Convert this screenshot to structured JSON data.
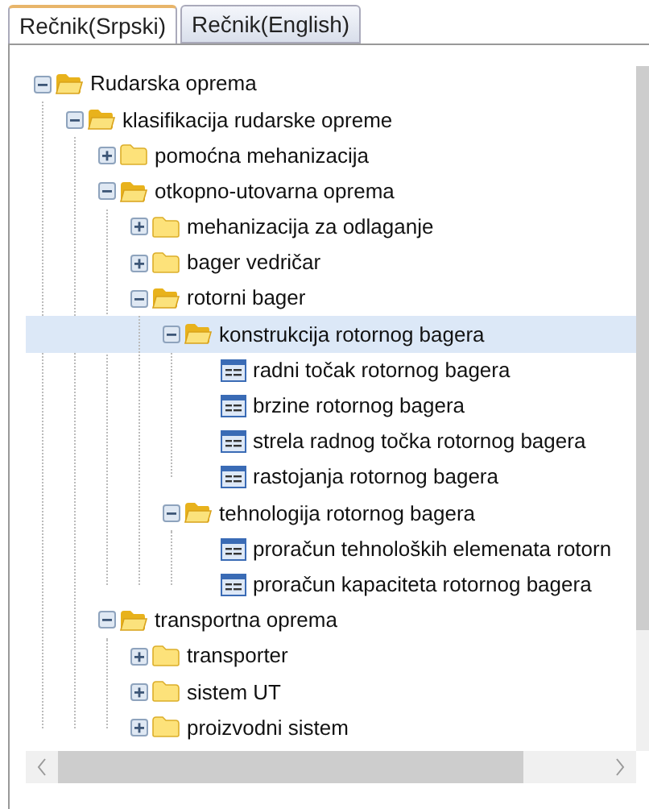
{
  "tabs": [
    {
      "label": "Rečnik(Srpski)",
      "selected": true
    },
    {
      "label": "Rečnik(English)",
      "selected": false
    }
  ],
  "tree": [
    {
      "label": "Rudarska oprema",
      "kind": "folder",
      "expanded": true,
      "selected": false,
      "children": [
        {
          "label": "klasifikacija rudarske opreme",
          "kind": "folder",
          "expanded": true,
          "selected": false,
          "children": [
            {
              "label": "pomoćna mehanizacija",
              "kind": "folder",
              "expanded": false,
              "selected": false
            },
            {
              "label": "otkopno-utovarna oprema",
              "kind": "folder",
              "expanded": true,
              "selected": false,
              "children": [
                {
                  "label": "mehanizacija za odlaganje",
                  "kind": "folder",
                  "expanded": false,
                  "selected": false
                },
                {
                  "label": "bager vedričar",
                  "kind": "folder",
                  "expanded": false,
                  "selected": false
                },
                {
                  "label": "rotorni bager",
                  "kind": "folder",
                  "expanded": true,
                  "selected": false,
                  "children": [
                    {
                      "label": "konstrukcija rotornog bagera",
                      "kind": "folder",
                      "expanded": true,
                      "selected": true,
                      "children": [
                        {
                          "label": "radni točak rotornog bagera",
                          "kind": "leaf",
                          "selected": false
                        },
                        {
                          "label": "brzine rotornog bagera",
                          "kind": "leaf",
                          "selected": false
                        },
                        {
                          "label": "strela radnog točka rotornog bagera",
                          "kind": "leaf",
                          "selected": false
                        },
                        {
                          "label": "rastojanja rotornog bagera",
                          "kind": "leaf",
                          "selected": false
                        }
                      ]
                    },
                    {
                      "label": "tehnologija rotornog bagera",
                      "kind": "folder",
                      "expanded": true,
                      "selected": false,
                      "children": [
                        {
                          "label": "proračun tehnoloških elemenata rotorn",
                          "kind": "leaf",
                          "selected": false
                        },
                        {
                          "label": "proračun kapaciteta rotornog bagera",
                          "kind": "leaf",
                          "selected": false
                        }
                      ]
                    }
                  ]
                }
              ]
            },
            {
              "label": "transportna oprema",
              "kind": "folder",
              "expanded": true,
              "selected": false,
              "children": [
                {
                  "label": "transporter",
                  "kind": "folder",
                  "expanded": false,
                  "selected": false
                },
                {
                  "label": "sistem UT",
                  "kind": "folder",
                  "expanded": false,
                  "selected": false
                },
                {
                  "label": "proizvodni sistem",
                  "kind": "folder",
                  "expanded": false,
                  "selected": false
                }
              ]
            }
          ]
        }
      ]
    }
  ]
}
